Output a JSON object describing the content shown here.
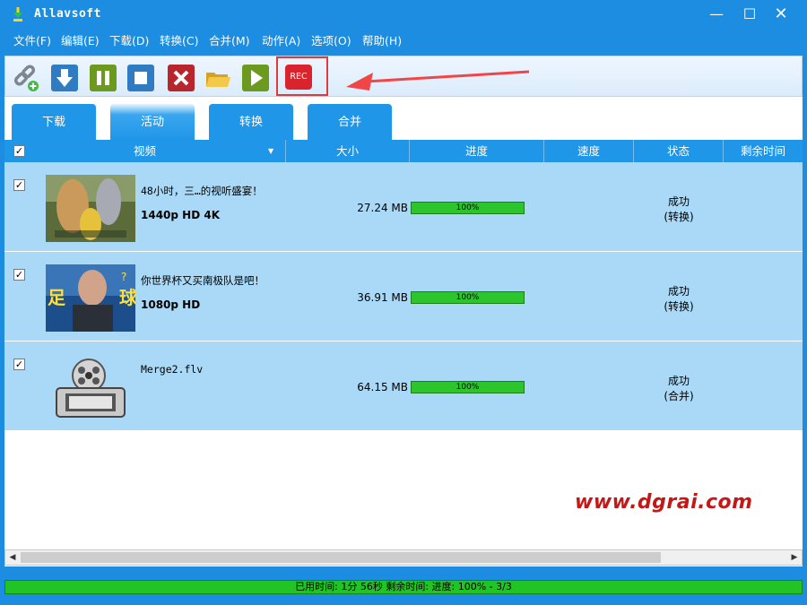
{
  "window": {
    "title": "Allavsoft"
  },
  "menu": [
    "文件(F)",
    "编辑(E)",
    "下载(D)",
    "转换(C)",
    "合并(M)",
    "动作(A)",
    "选项(O)",
    "帮助(H)"
  ],
  "toolbar": {
    "buttons": [
      "add-url",
      "download",
      "pause",
      "stop",
      "delete",
      "open-folder",
      "play"
    ],
    "rec_label": "REC"
  },
  "tabs": [
    "下载",
    "活动",
    "转换",
    "合并"
  ],
  "active_tab": "活动",
  "columns": [
    "视频",
    "大小",
    "进度",
    "速度",
    "状态",
    "剩余时间"
  ],
  "rows": [
    {
      "name": "48小时，三…的视听盛宴！",
      "quality": "1440p HD 4K",
      "size": "27.24 MB",
      "progress": "100%",
      "status": "成功",
      "status_detail": "(转换)"
    },
    {
      "name": "你世界杯又买南极队是吧！",
      "quality": "1080p HD",
      "size": "36.91 MB",
      "progress": "100%",
      "status": "成功",
      "status_detail": "(转换)"
    },
    {
      "name": "Merge2.flv",
      "quality": "",
      "size": "64.15 MB",
      "progress": "100%",
      "status": "成功",
      "status_detail": "(合并)"
    }
  ],
  "status_bar": "已用时间:  1分 56秒  剩余时间:  进度: 100% - 3/3",
  "watermark": "www.dgrai.com",
  "colors": {
    "title_bar": "#1c8de0",
    "row_bg": "#a9d9f6",
    "progress": "#2cc62c",
    "rec": "#d9232d"
  }
}
